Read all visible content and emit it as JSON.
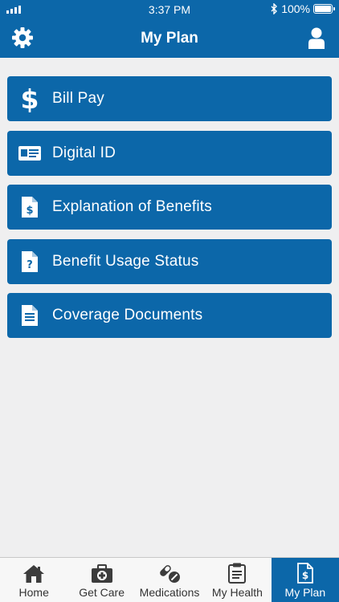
{
  "status_bar": {
    "time": "3:37 PM",
    "battery": "100%"
  },
  "header": {
    "title": "My Plan",
    "settings_icon": "gear-icon",
    "profile_icon": "user-icon"
  },
  "menu": [
    {
      "label": "Bill Pay",
      "icon": "dollar-icon"
    },
    {
      "label": "Digital ID",
      "icon": "id-card-icon"
    },
    {
      "label": "Explanation of Benefits",
      "icon": "document-dollar-icon"
    },
    {
      "label": "Benefit Usage Status",
      "icon": "document-question-icon"
    },
    {
      "label": "Coverage Documents",
      "icon": "document-icon"
    }
  ],
  "tabs": [
    {
      "label": "Home",
      "icon": "home-icon"
    },
    {
      "label": "Get Care",
      "icon": "first-aid-kit-icon"
    },
    {
      "label": "Medications",
      "icon": "pills-icon"
    },
    {
      "label": "My Health",
      "icon": "clipboard-icon"
    },
    {
      "label": "My Plan",
      "icon": "document-dollar-icon",
      "active": true
    }
  ],
  "colors": {
    "primary": "#0c67a9",
    "background": "#efeff0",
    "tab_bar": "#f7f7f7"
  }
}
